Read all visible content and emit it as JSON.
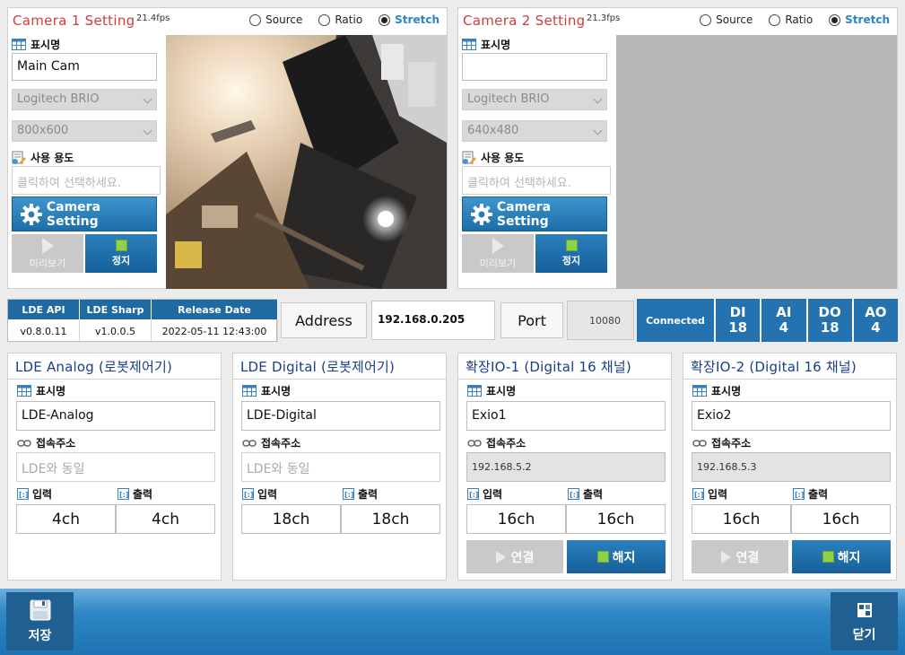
{
  "cameras": [
    {
      "title": "Camera 1 Setting",
      "fps": "21.4fps",
      "radios": [
        "Source",
        "Ratio",
        "Stretch"
      ],
      "selected": "Stretch",
      "name_label": "표시명",
      "name_value": "Main Cam",
      "device": "Logitech BRIO",
      "resolution": "800x600",
      "usage_label": "사용 용도",
      "usage_placeholder": "클릭하여 선택하세요.",
      "camera_setting_label": "Camera Setting",
      "preview_label": "미리보기",
      "stop_label": "정지"
    },
    {
      "title": "Camera 2 Setting",
      "fps": "21.3fps",
      "radios": [
        "Source",
        "Ratio",
        "Stretch"
      ],
      "selected": "Stretch",
      "name_label": "표시명",
      "name_value": "",
      "device": "Logitech BRIO",
      "resolution": "640x480",
      "usage_label": "사용 용도",
      "usage_placeholder": "클릭하여 선택하세요.",
      "camera_setting_label": "Camera Setting",
      "preview_label": "미리보기",
      "stop_label": "정지"
    }
  ],
  "info": {
    "headers": [
      "LDE API",
      "LDE Sharp",
      "Release Date"
    ],
    "values": [
      "v0.8.0.11",
      "v1.0.0.5",
      "2022-05-11 12:43:00"
    ],
    "address_label": "Address",
    "address_value": "192.168.0.205",
    "port_label": "Port",
    "port_value": "10080",
    "status": "Connected",
    "counts": [
      {
        "label": "DI",
        "value": "18"
      },
      {
        "label": "AI",
        "value": "4"
      },
      {
        "label": "DO",
        "value": "18"
      },
      {
        "label": "AO",
        "value": "4"
      }
    ]
  },
  "devices": [
    {
      "title": "LDE Analog (로봇제어기)",
      "name_label": "표시명",
      "name_value": "LDE-Analog",
      "addr_label": "접속주소",
      "addr_value": "LDE와 동일",
      "in_label": "입력",
      "out_label": "출력",
      "in_value": "4ch",
      "out_value": "4ch"
    },
    {
      "title": "LDE Digital (로봇제어기)",
      "name_label": "표시명",
      "name_value": "LDE-Digital",
      "addr_label": "접속주소",
      "addr_value": "LDE와 동일",
      "in_label": "입력",
      "out_label": "출력",
      "in_value": "18ch",
      "out_value": "18ch"
    },
    {
      "title": "확장IO-1 (Digital 16 채널)",
      "name_label": "표시명",
      "name_value": "Exio1",
      "addr_label": "접속주소",
      "addr_value": "192.168.5.2",
      "in_label": "입력",
      "out_label": "출력",
      "in_value": "16ch",
      "out_value": "16ch",
      "connect_label": "연결",
      "release_label": "해지"
    },
    {
      "title": "확장IO-2 (Digital 16 채널)",
      "name_label": "표시명",
      "name_value": "Exio2",
      "addr_label": "접속주소",
      "addr_value": "192.168.5.3",
      "in_label": "입력",
      "out_label": "출력",
      "in_value": "16ch",
      "out_value": "16ch",
      "connect_label": "연결",
      "release_label": "해지"
    }
  ],
  "bottom": {
    "save_label": "저장",
    "close_label": "닫기"
  },
  "colors": {
    "accent_blue": "#1f6aa2",
    "camera_title_red": "#d23c3c",
    "device_title_navy": "#1a3e8a",
    "status_green": "#8ed24a"
  }
}
